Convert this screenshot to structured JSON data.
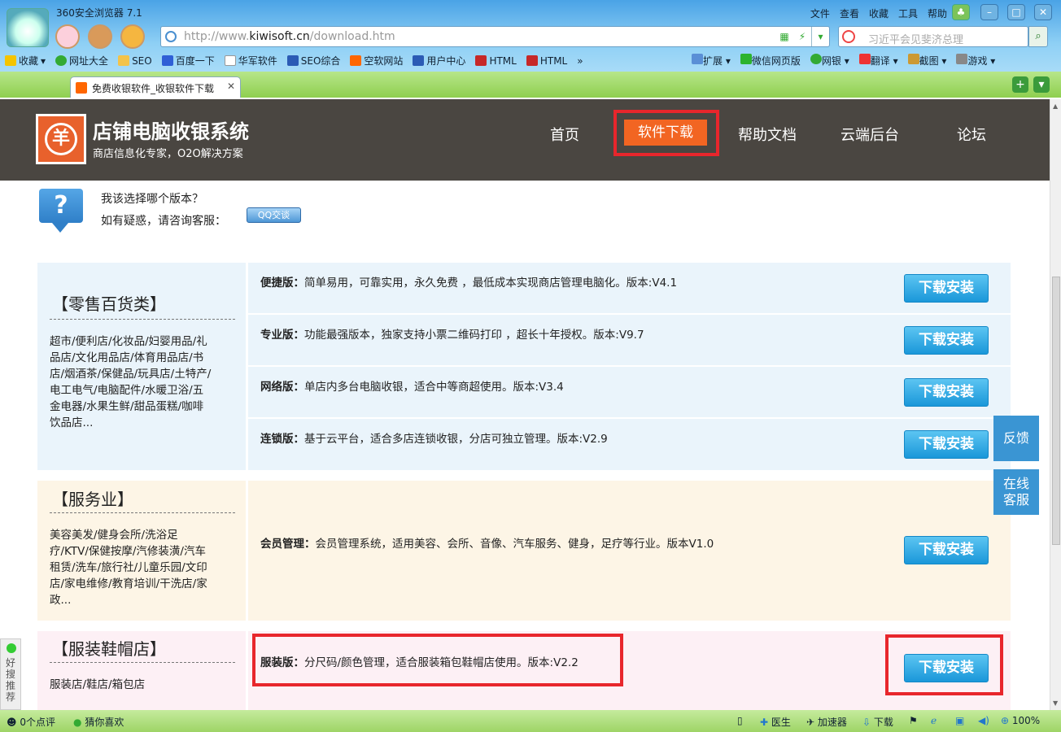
{
  "browser": {
    "title": "360安全浏览器 7.1",
    "menu": [
      "文件",
      "查看",
      "收藏",
      "工具",
      "帮助"
    ],
    "url_prefix": "http://www.",
    "url_domain": "kiwisoft.cn",
    "url_path": "/download.htm",
    "search_placeholder": "习近平会见斐济总理",
    "bookmarks": [
      "收藏",
      "网址大全",
      "SEO",
      "百度一下",
      "华军软件",
      "SEO综合",
      "空软网站",
      "用户中心",
      "HTML",
      "HTML"
    ],
    "bookmarks_right": [
      "扩展",
      "微信网页版",
      "网银",
      "翻译",
      "截图",
      "游戏"
    ],
    "tab_title": "免费收银软件_收银软件下载"
  },
  "site": {
    "name": "店铺电脑收银系统",
    "slogan": "商店信息化专家，O2O解决方案",
    "logo_char": "羊",
    "nav": [
      "首页",
      "软件下载",
      "帮助文档",
      "云端后台",
      "论坛"
    ],
    "nav_active_index": 1
  },
  "help": {
    "question": "我该选择哪个版本？",
    "consult": "如有疑惑，请咨询客服：",
    "qq_label": "QQ交谈",
    "icon": "question-icon"
  },
  "download_label": "下载安装",
  "categories": [
    {
      "title": "【零售百货类】",
      "desc": [
        "超市/便利店/化妆品/妇婴用品/礼",
        "品店/文化用品店/体育用品店/书",
        "店/烟酒茶/保健品/玩具店/土特产/",
        "电工电气/电脑配件/水暖卫浴/五",
        "金电器/水果生鲜/甜品蛋糕/咖啡",
        "饮品店..."
      ],
      "items": [
        {
          "name": "便捷版：",
          "text": "简单易用，可靠实用，永久免费 ，最低成本实现商店管理电脑化。版本:V4.1"
        },
        {
          "name": "专业版：",
          "text": "功能最强版本，独家支持小票二维码打印 ，超长十年授权。版本:V9.7"
        },
        {
          "name": "网络版：",
          "text": "单店内多台电脑收银，适合中等商超使用。版本:V3.4"
        },
        {
          "name": "连锁版：",
          "text": "基于云平台，适合多店连锁收银，分店可独立管理。版本:V2.9"
        }
      ]
    },
    {
      "title": "【服务业】",
      "desc": [
        "美容美发/健身会所/洗浴足",
        "疗/KTV/保健按摩/汽修装潢/汽车",
        "租赁/洗车/旅行社/儿童乐园/文印",
        "店/家电维修/教育培训/干洗店/家",
        "政..."
      ],
      "items": [
        {
          "name": "会员管理：",
          "text": "会员管理系统，适用美容、会所、音像、汽车服务、健身，足疗等行业。版本V1.0"
        }
      ]
    },
    {
      "title": "【服装鞋帽店】",
      "desc": [
        "服装店/鞋店/箱包店"
      ],
      "items": [
        {
          "name": "服装版：",
          "text": "分尺码/颜色管理，适合服装箱包鞋帽店使用。版本:V2.2"
        }
      ]
    }
  ],
  "side": {
    "feedback": "反馈",
    "online1": "在线",
    "online2": "客服"
  },
  "left_strip": [
    "好",
    "搜",
    "推",
    "荐"
  ],
  "status": {
    "comments": "0个点评",
    "guess": "猜你喜欢",
    "doctor": "医生",
    "accel": "加速器",
    "download": "下载",
    "zoom": "100%"
  },
  "colors": {
    "accent": "#f26522",
    "header_bg": "#4a4641",
    "highlight": "#e8262c",
    "button": "#1a97d9"
  }
}
